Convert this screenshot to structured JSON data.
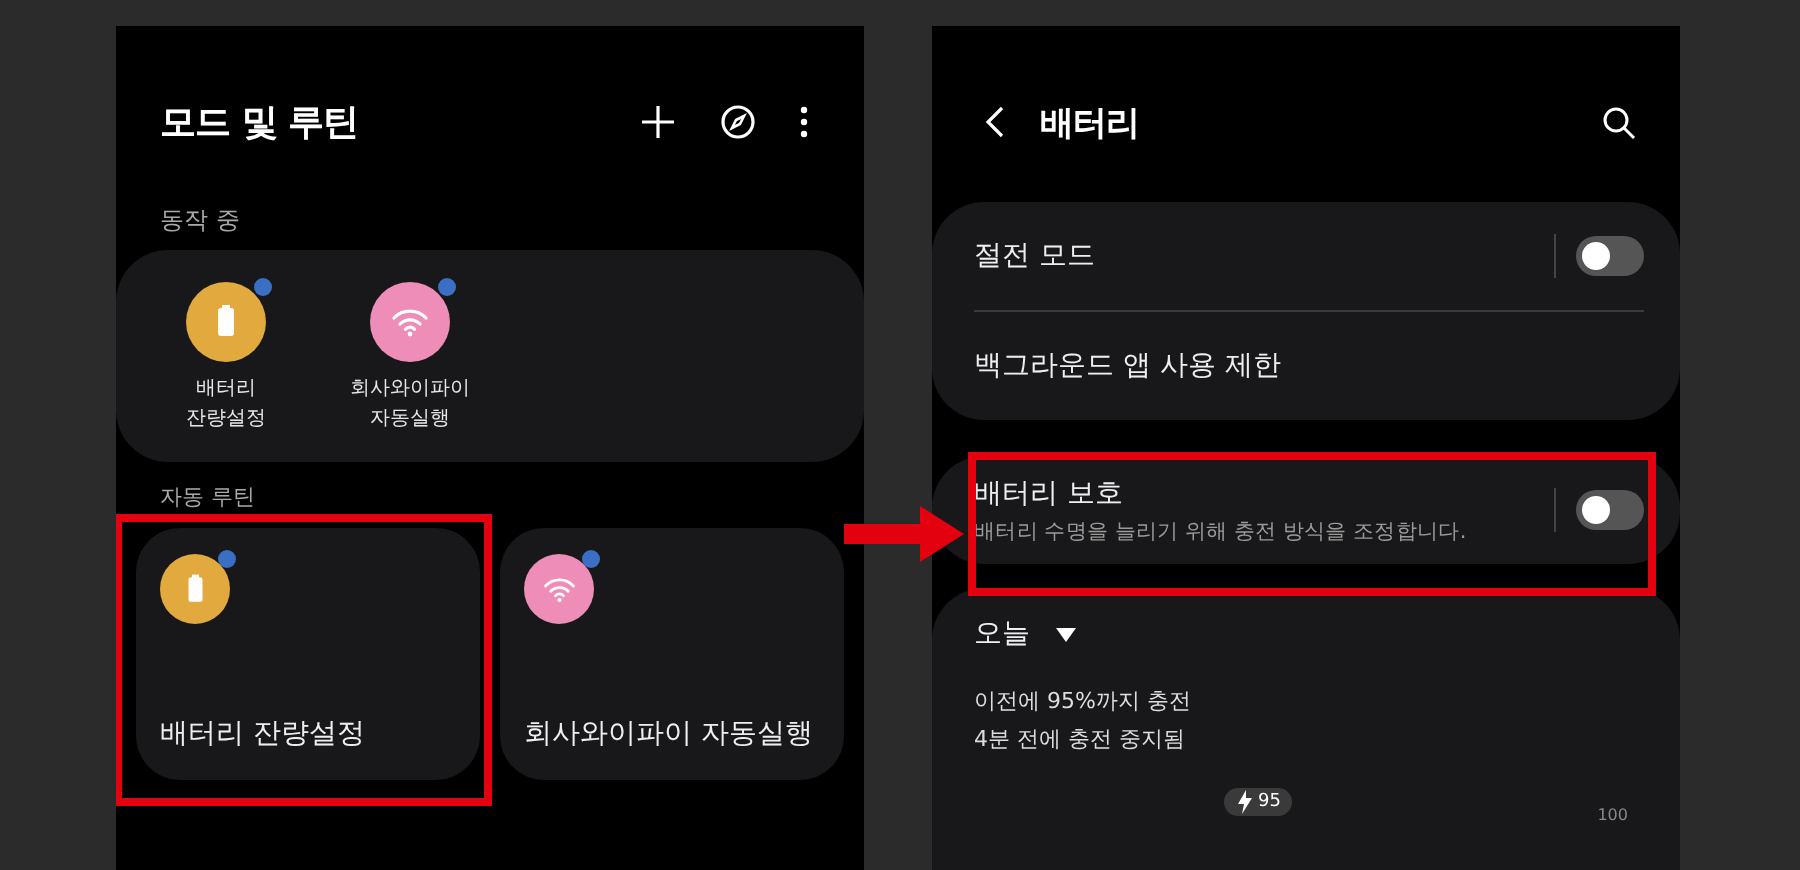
{
  "left_screen": {
    "title": "모드 및 루틴",
    "running": {
      "label": "동작 중",
      "items": [
        {
          "kind": "battery",
          "color": "#e2a93e",
          "label": "배터리\n잔량설정",
          "notified": true
        },
        {
          "kind": "wifi",
          "color": "#ee8db8",
          "label": "회사와이파이\n자동실행",
          "notified": true
        }
      ]
    },
    "routines": {
      "label": "자동 루틴",
      "items": [
        {
          "kind": "battery",
          "color": "#e2a93e",
          "label": "배터리 잔량설정",
          "notified": true,
          "highlighted": true
        },
        {
          "kind": "wifi",
          "color": "#ee8db8",
          "label": "회사와이파이 자동실행",
          "notified": true,
          "highlighted": false
        }
      ]
    }
  },
  "right_screen": {
    "title": "배터리",
    "groups": [
      {
        "rows": [
          {
            "label": "절전 모드",
            "on": false
          },
          {
            "label": "백그라운드 앱 사용 제한"
          }
        ],
        "highlighted": false
      },
      {
        "rows": [
          {
            "label": "배터리 보호",
            "description": "배터리 수명을 늘리기 위해 충전 방식을 조정합니다.",
            "on": false
          }
        ],
        "highlighted": true
      }
    ],
    "usage": {
      "period": "오늘",
      "lines": [
        "이전에 95%까지 충전",
        "4분 전에 충전 중지됨"
      ],
      "charge_marker": "95",
      "axis_label": "100"
    }
  }
}
